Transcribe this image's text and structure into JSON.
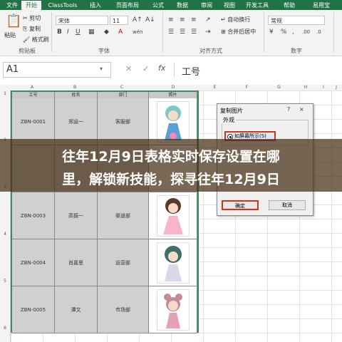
{
  "tabs": [
    "文件",
    "开始",
    "ClassTools",
    "插入",
    "页面布局",
    "公式",
    "数据",
    "审阅",
    "视图",
    "开发工具",
    "帮助",
    "易用宝"
  ],
  "ribbon": {
    "clipboard": {
      "paste": "粘贴",
      "cut": "剪切",
      "copy": "复制",
      "format_painter": "格式刷",
      "group_label": "剪贴板"
    },
    "font": {
      "name": "宋体",
      "size": "11",
      "group_label": "字体"
    },
    "alignment": {
      "wrap": "自动换行",
      "merge": "合并后居中",
      "group_label": "对齐方式"
    },
    "number": {
      "format": "常规",
      "group_label": "数字"
    }
  },
  "formula_bar": {
    "cell_ref": "A1",
    "content": "工号"
  },
  "sheet": {
    "columns": [
      "A",
      "B",
      "C",
      "D",
      "E",
      "F",
      "G",
      "H",
      "I",
      "J"
    ],
    "rows": [
      "1",
      "2",
      "3",
      "4",
      "5",
      "6"
    ],
    "headers": [
      "工号",
      "姓名",
      "部门",
      "照片"
    ],
    "data": [
      {
        "id": "ZBN-0001",
        "name": "郑运一",
        "dept": "客服部"
      },
      {
        "id": "",
        "name": "",
        "dept": ""
      },
      {
        "id": "ZBN-0003",
        "name": "高振一",
        "dept": "渠道部"
      },
      {
        "id": "ZBN-0004",
        "name": "肖嘉思",
        "dept": "运营部"
      },
      {
        "id": "ZBN-0005",
        "name": "谭文",
        "dept": "市场部"
      }
    ]
  },
  "dialog": {
    "title": "复制图片",
    "group_label": "外观",
    "radio_label": "如屏幕所示(S)",
    "ok": "确定",
    "cancel": "取消",
    "help": "?",
    "close": "×"
  },
  "banner": {
    "line1": "往年12月9日表格实时保存设置在哪",
    "line2": "里，解锁新技能，探寻往年12月9日"
  },
  "colors": {
    "excel_green": "#217346",
    "highlight_red": "#d9301a",
    "banner_bg": "#462e16"
  }
}
